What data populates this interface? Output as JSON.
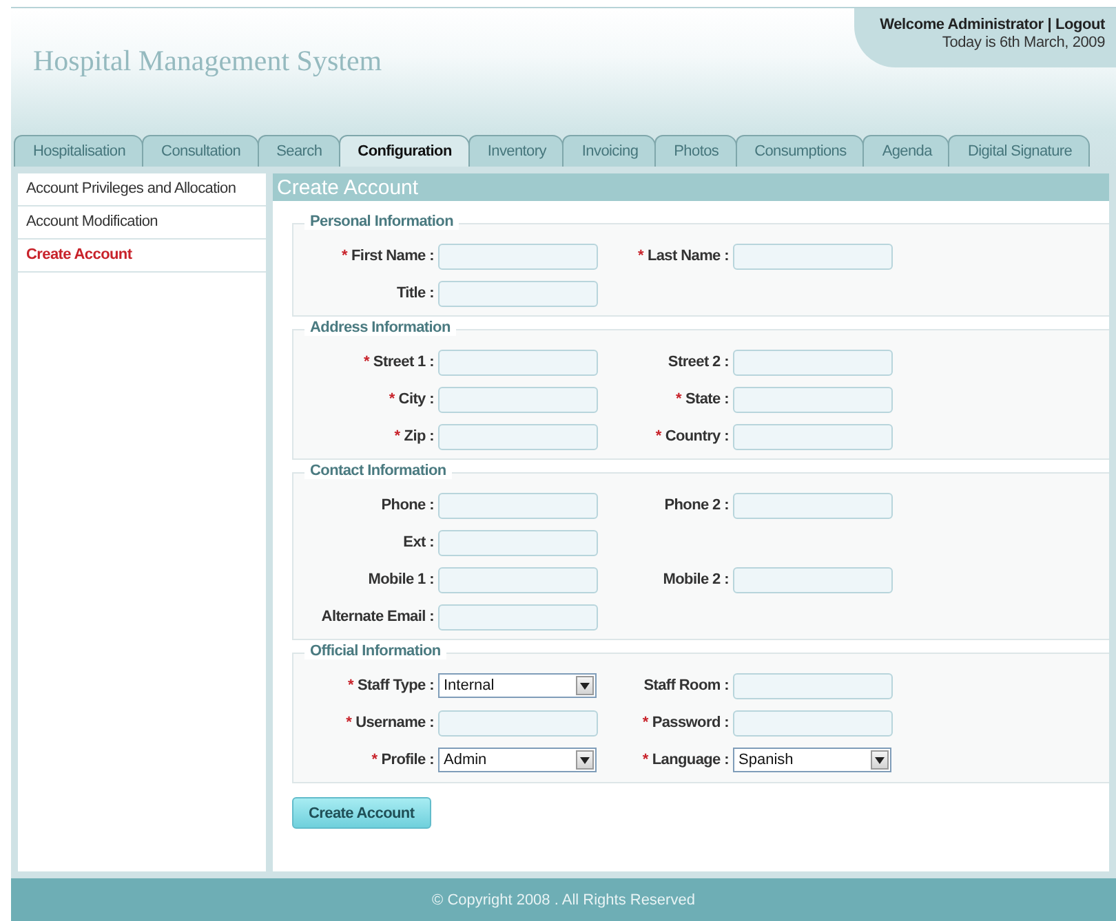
{
  "header": {
    "title": "Hospital Management System",
    "welcome": "Welcome Administrator",
    "separator": "|",
    "logout": "Logout",
    "date": "Today is 6th March, 2009"
  },
  "tabs": [
    {
      "label": "Hospitalisation",
      "selected": false
    },
    {
      "label": "Consultation",
      "selected": false
    },
    {
      "label": "Search",
      "selected": false
    },
    {
      "label": "Configuration",
      "selected": true
    },
    {
      "label": "Inventory",
      "selected": false
    },
    {
      "label": "Invoicing",
      "selected": false
    },
    {
      "label": "Photos",
      "selected": false
    },
    {
      "label": "Consumptions",
      "selected": false
    },
    {
      "label": "Agenda",
      "selected": false
    },
    {
      "label": "Digital Signature",
      "selected": false
    }
  ],
  "sidebar": {
    "items": [
      {
        "label": "Account Privileges and Allocation",
        "selected": false
      },
      {
        "label": "Account Modification",
        "selected": false
      },
      {
        "label": "Create Account",
        "selected": true
      }
    ]
  },
  "page_title": "Create Account",
  "sections": [
    {
      "legend": "Personal Information",
      "rows": [
        [
          {
            "kind": "text",
            "mark": "*",
            "label": "First Name :"
          },
          {
            "kind": "text",
            "mark": "*",
            "label": "Last Name :"
          }
        ],
        [
          {
            "kind": "text",
            "label": "Title :"
          }
        ]
      ]
    },
    {
      "legend": "Address Information",
      "rows": [
        [
          {
            "kind": "text",
            "mark": "*",
            "label": "Street 1 :"
          },
          {
            "kind": "text",
            "label": "Street 2 :"
          }
        ],
        [
          {
            "kind": "text",
            "mark": "*",
            "label": "City :"
          },
          {
            "kind": "text",
            "mark": "*",
            "label": "State :"
          }
        ],
        [
          {
            "kind": "text",
            "mark": "*",
            "label": "Zip :"
          },
          {
            "kind": "text",
            "mark": "*",
            "label": "Country :"
          }
        ]
      ]
    },
    {
      "legend": "Contact Information",
      "rows": [
        [
          {
            "kind": "text",
            "label": "Phone :"
          },
          {
            "kind": "text",
            "label": "Phone 2 :"
          }
        ],
        [
          {
            "kind": "text",
            "label": "Ext :"
          }
        ],
        [
          {
            "kind": "text",
            "label": "Mobile 1 :"
          },
          {
            "kind": "text",
            "label": "Mobile 2 :"
          }
        ],
        [
          {
            "kind": "text",
            "label": "Alternate Email :"
          }
        ]
      ]
    },
    {
      "legend": "Official Information",
      "rows": [
        [
          {
            "kind": "select",
            "mark": "*",
            "label": "Staff Type :",
            "value": "Internal"
          },
          {
            "kind": "text",
            "label": "Staff Room :"
          }
        ],
        [
          {
            "kind": "text",
            "mark": "*",
            "label": "Username :"
          },
          {
            "kind": "text",
            "mark": "*",
            "label": "Password :"
          }
        ],
        [
          {
            "kind": "select",
            "mark": "*",
            "label": "Profile :",
            "value": "Admin"
          },
          {
            "kind": "select",
            "mark": "*",
            "label": "Language :",
            "value": "Spanish"
          }
        ]
      ]
    }
  ],
  "submit_button": "Create Account",
  "footer": "© Copyright 2008 . All Rights Reserved"
}
